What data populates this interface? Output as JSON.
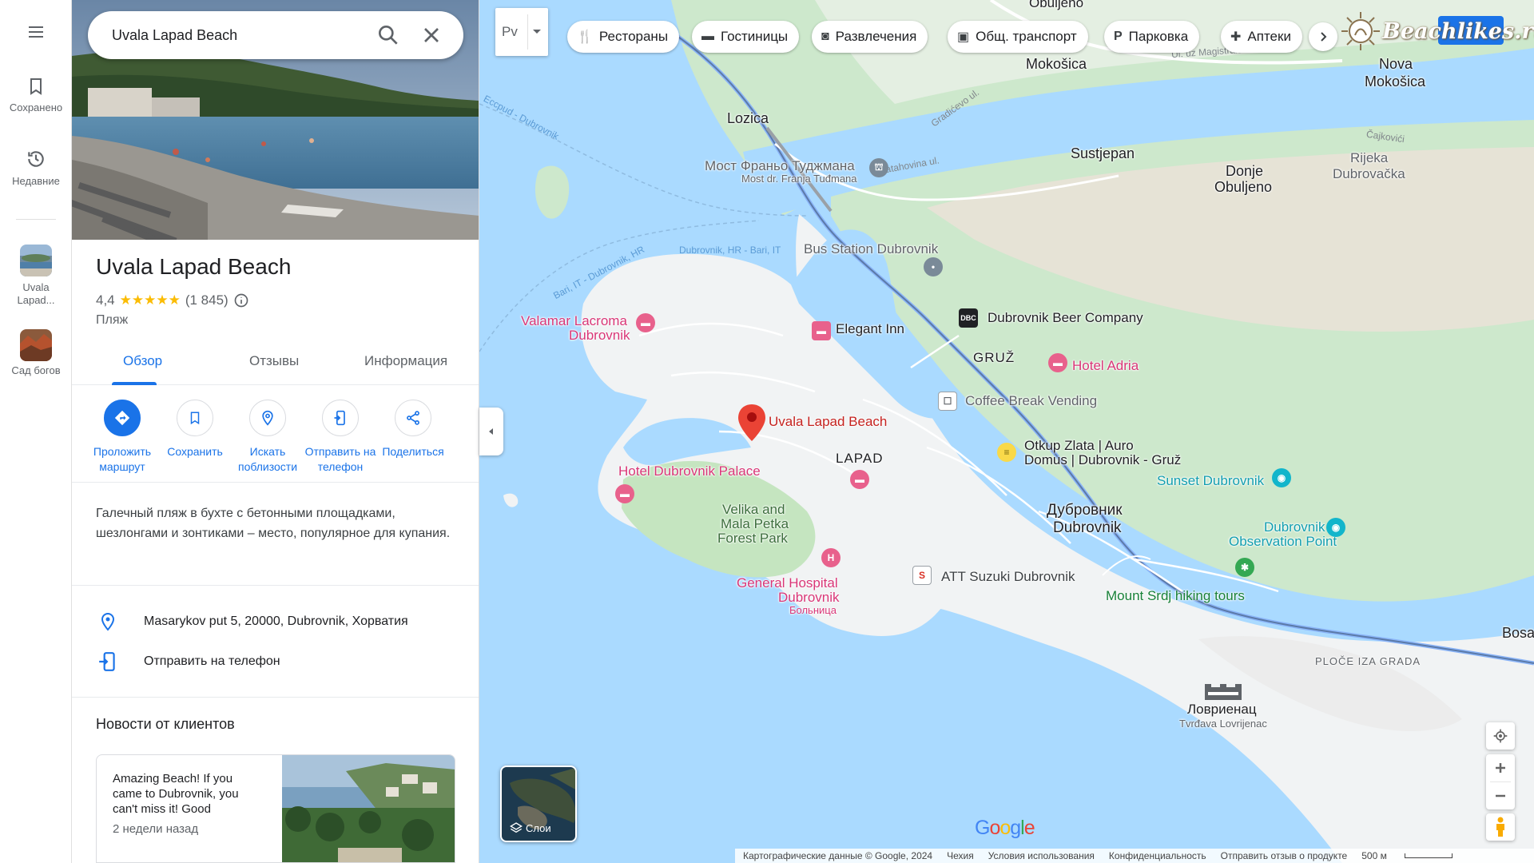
{
  "rail": {
    "saved_label": "Сохранено",
    "recent_label": "Недавние",
    "recents": [
      {
        "label": "Uvala Lapad..."
      },
      {
        "label": "Сад богов"
      }
    ]
  },
  "search": {
    "value": "Uvala Lapad Beach"
  },
  "place": {
    "title": "Uvala Lapad Beach",
    "rating": "4,4",
    "stars": "★★★★★",
    "reviews_count": "(1 845)",
    "type": "Пляж",
    "tabs": [
      {
        "label": "Обзор",
        "active": true
      },
      {
        "label": "Отзывы",
        "active": false
      },
      {
        "label": "Информация",
        "active": false
      }
    ],
    "actions": [
      {
        "label": "Проложить маршрут",
        "icon": "directions-icon"
      },
      {
        "label": "Сохранить",
        "icon": "bookmark-icon"
      },
      {
        "label": "Искать поблизости",
        "icon": "nearby-icon"
      },
      {
        "label": "Отправить на телефон",
        "icon": "send-to-phone-icon"
      },
      {
        "label": "Поделиться",
        "icon": "share-icon"
      }
    ],
    "description": "Галечный пляж в бухте с бетонными площадками, шезлонгами и зонтиками – место, популярное для купания.",
    "address": "Masarykov put 5, 20000, Dubrovnik, Хорватия",
    "send_to_phone": "Отправить на телефон",
    "news_title": "Новости от клиентов",
    "news": {
      "text": "Amazing Beach! If you came to Dubrovnik, you can't miss it! Good",
      "date": "2 недели назад"
    }
  },
  "map": {
    "layer_selector_label": "Рv",
    "chips": [
      {
        "label": "Рестораны",
        "icon": "restaurant-icon"
      },
      {
        "label": "Гостиницы",
        "icon": "hotel-icon"
      },
      {
        "label": "Развлечения",
        "icon": "camera-icon"
      },
      {
        "label": "Общ. транспорт",
        "icon": "transit-icon"
      },
      {
        "label": "Парковка",
        "icon": "parking-icon"
      },
      {
        "label": "Аптеки",
        "icon": "pharmacy-icon"
      }
    ],
    "watermark": "Beachlikes.ru",
    "layers_label": "Слои",
    "labels": {
      "obuljeno": "Obuljeno",
      "mokosica": "Mokošica",
      "nova_mokosica_1": "Nova",
      "nova_mokosica_2": "Mokošica",
      "lozica": "Lozica",
      "sustjepan": "Sustjepan",
      "donje_obuljeno_1": "Donje",
      "donje_obuljeno_2": "Obuljeno",
      "rijeka_1": "Rijeka",
      "rijeka_2": "Dubrovačka",
      "bridge_1": "Мост Франьо Туджмана",
      "bridge_2": "Most dr. Franja Tuđmana",
      "bus_station": "Bus Station Dubrovnik",
      "valamar_1": "Valamar Lacroma",
      "valamar_2": "Dubrovnik",
      "elegant_inn": "Elegant Inn",
      "beer_company": "Dubrovnik Beer Company",
      "gruz": "GRUŽ",
      "hotel_adria": "Hotel Adria",
      "coffee_break": "Coffee Break Vending",
      "uvala_pin": "Uvala Lapad Beach",
      "lapad": "LAPAD",
      "otkup_1": "Otkup Zlata | Auro",
      "otkup_2": "Domus | Dubrovnik - Gruž",
      "sunset": "Sunset Dubrovnik",
      "hotel_palace": "Hotel Dubrovnik Palace",
      "velika_1": "Velika and",
      "velika_2": "Mala Petka",
      "velika_3": "Forest Park",
      "dubrovnik_ru": "Дубровник",
      "dubrovnik_en": "Dubrovnik",
      "observation_1": "Dubrovnik",
      "observation_2": "Observation Point",
      "hospital_1": "General Hospital",
      "hospital_2": "Dubrovnik",
      "hospital_3": "Больница",
      "suzuki": "ATT Suzuki Dubrovnik",
      "srdj": "Mount Srdj hiking tours",
      "ploce": "PLOČE IZA GRADA",
      "bosa": "Bosa",
      "lovrijenac_1": "Ловриенац",
      "lovrijenac_2": "Tvrđava Lovrijenac",
      "street_magistralu": "Ul. uz Magistralu",
      "street_gradicevo": "Gradićevo ul.",
      "street_batahovina": "Batahovina ul.",
      "street_cajkovici": "Čajkovići",
      "street_eccpud": "Eccpud - Dubrovnik",
      "street_bari1": "Dubrovnik, HR - Bari, IT",
      "street_bari2": "Bari, IT - Dubrovnik, HR"
    },
    "google": "Google",
    "footer": {
      "copyright": "Картографические данные © Google, 2024",
      "country": "Чехия",
      "terms": "Условия использования",
      "privacy": "Конфиденциальность",
      "feedback": "Отправить отзыв о продукте",
      "scale": "500 м"
    }
  }
}
